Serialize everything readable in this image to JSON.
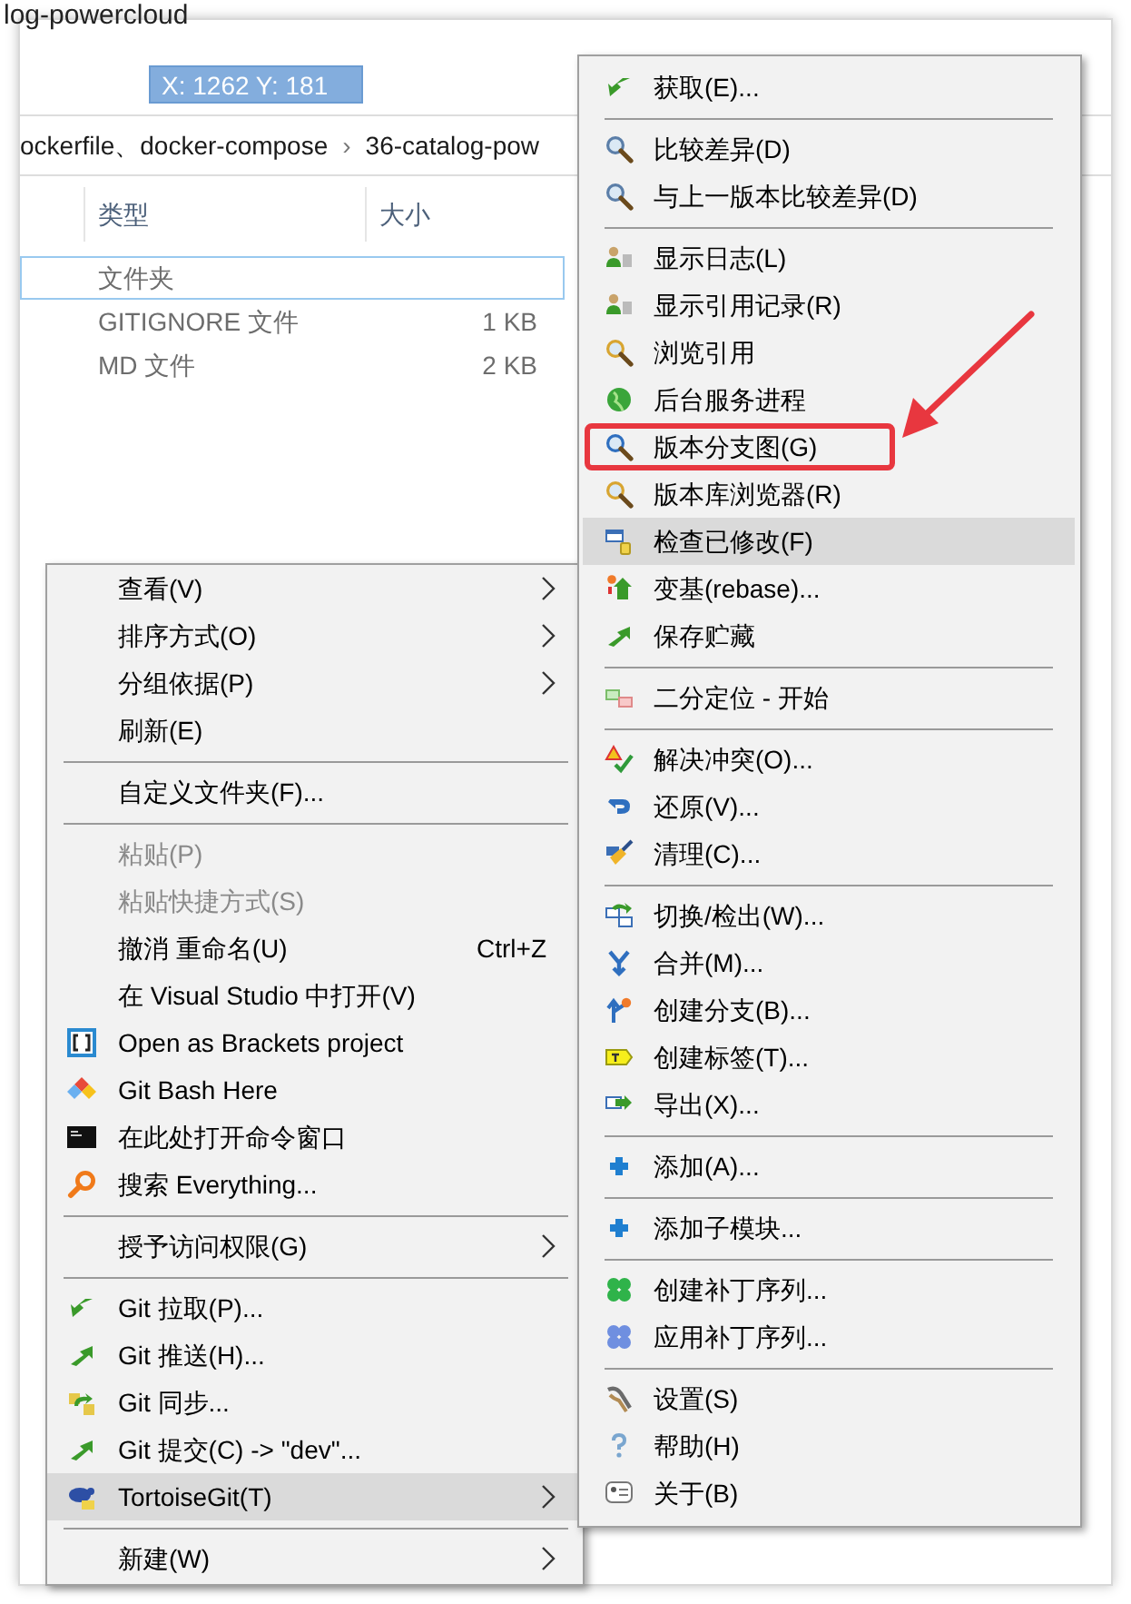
{
  "explorer": {
    "title": "log-powercloud",
    "breadcrumb": [
      {
        "label": "ockerfile、docker-compose"
      },
      {
        "label": "›"
      },
      {
        "label": "36-catalog-pow"
      }
    ],
    "tooltip": "X: 1262 Y: 181",
    "columns": [
      "类型",
      "大小"
    ],
    "rows": [
      {
        "type": "文件夹",
        "size": "",
        "selected": true
      },
      {
        "type": "GITIGNORE 文件",
        "size": "1 KB",
        "selected": false
      },
      {
        "type": "MD 文件",
        "size": "2 KB",
        "selected": false
      }
    ]
  },
  "context_menu": {
    "items": [
      {
        "kind": "item",
        "label": "查看(V)",
        "submenu": true,
        "disabled": false,
        "selected": false
      },
      {
        "kind": "item",
        "label": "排序方式(O)",
        "submenu": true,
        "disabled": false,
        "selected": false
      },
      {
        "kind": "item",
        "label": "分组依据(P)",
        "submenu": true,
        "disabled": false,
        "selected": false
      },
      {
        "kind": "item",
        "label": "刷新(E)",
        "submenu": false,
        "disabled": false,
        "selected": false
      },
      {
        "kind": "separator"
      },
      {
        "kind": "item",
        "label": "自定义文件夹(F)...",
        "submenu": false,
        "disabled": false,
        "selected": false
      },
      {
        "kind": "separator"
      },
      {
        "kind": "item",
        "label": "粘贴(P)",
        "submenu": false,
        "disabled": true,
        "selected": false
      },
      {
        "kind": "item",
        "label": "粘贴快捷方式(S)",
        "submenu": false,
        "disabled": true,
        "selected": false
      },
      {
        "kind": "item",
        "label": "撤消 重命名(U)",
        "shortcut": "Ctrl+Z",
        "submenu": false,
        "disabled": false,
        "selected": false
      },
      {
        "kind": "item",
        "label": "在 Visual Studio 中打开(V)",
        "submenu": false,
        "disabled": false,
        "selected": false
      },
      {
        "kind": "item",
        "label": "Open as Brackets project",
        "submenu": false,
        "disabled": false,
        "selected": false
      },
      {
        "kind": "item",
        "label": "Git Bash Here",
        "submenu": false,
        "disabled": false,
        "selected": false
      },
      {
        "kind": "item",
        "label": "在此处打开命令窗口",
        "submenu": false,
        "disabled": false,
        "selected": false
      },
      {
        "kind": "item",
        "label": "搜索 Everything...",
        "submenu": false,
        "disabled": false,
        "selected": false
      },
      {
        "kind": "separator"
      },
      {
        "kind": "item",
        "label": "授予访问权限(G)",
        "submenu": true,
        "disabled": false,
        "selected": false
      },
      {
        "kind": "separator"
      },
      {
        "kind": "item",
        "label": "Git 拉取(P)...",
        "submenu": false,
        "disabled": false,
        "selected": false
      },
      {
        "kind": "item",
        "label": "Git 推送(H)...",
        "submenu": false,
        "disabled": false,
        "selected": false
      },
      {
        "kind": "item",
        "label": "Git 同步...",
        "submenu": false,
        "disabled": false,
        "selected": false
      },
      {
        "kind": "item",
        "label": "Git 提交(C) -> \"dev\"...",
        "submenu": false,
        "disabled": false,
        "selected": false
      },
      {
        "kind": "item",
        "label": "TortoiseGit(T)",
        "submenu": true,
        "disabled": false,
        "selected": true
      },
      {
        "kind": "separator"
      },
      {
        "kind": "item",
        "label": "新建(W)",
        "submenu": true,
        "disabled": false,
        "selected": false
      }
    ]
  },
  "submenu": {
    "items": [
      {
        "kind": "item",
        "label": "获取(E)...",
        "selected": false,
        "annotated": false
      },
      {
        "kind": "separator"
      },
      {
        "kind": "item",
        "label": "比较差异(D)",
        "selected": false,
        "annotated": false
      },
      {
        "kind": "item",
        "label": "与上一版本比较差异(D)",
        "selected": false,
        "annotated": false
      },
      {
        "kind": "separator"
      },
      {
        "kind": "item",
        "label": "显示日志(L)",
        "selected": false,
        "annotated": false
      },
      {
        "kind": "item",
        "label": "显示引用记录(R)",
        "selected": false,
        "annotated": false
      },
      {
        "kind": "item",
        "label": "浏览引用",
        "selected": false,
        "annotated": false
      },
      {
        "kind": "item",
        "label": "后台服务进程",
        "selected": false,
        "annotated": false
      },
      {
        "kind": "item",
        "label": "版本分支图(G)",
        "selected": false,
        "annotated": true
      },
      {
        "kind": "item",
        "label": "版本库浏览器(R)",
        "selected": false,
        "annotated": false
      },
      {
        "kind": "item",
        "label": "检查已修改(F)",
        "selected": true,
        "annotated": false
      },
      {
        "kind": "item",
        "label": "变基(rebase)...",
        "selected": false,
        "annotated": false
      },
      {
        "kind": "item",
        "label": "保存贮藏",
        "selected": false,
        "annotated": false
      },
      {
        "kind": "separator"
      },
      {
        "kind": "item",
        "label": "二分定位 - 开始",
        "selected": false,
        "annotated": false
      },
      {
        "kind": "separator"
      },
      {
        "kind": "item",
        "label": "解决冲突(O)...",
        "selected": false,
        "annotated": false
      },
      {
        "kind": "item",
        "label": "还原(V)...",
        "selected": false,
        "annotated": false
      },
      {
        "kind": "item",
        "label": "清理(C)...",
        "selected": false,
        "annotated": false
      },
      {
        "kind": "separator"
      },
      {
        "kind": "item",
        "label": "切换/检出(W)...",
        "selected": false,
        "annotated": false
      },
      {
        "kind": "item",
        "label": "合并(M)...",
        "selected": false,
        "annotated": false
      },
      {
        "kind": "item",
        "label": "创建分支(B)...",
        "selected": false,
        "annotated": false
      },
      {
        "kind": "item",
        "label": "创建标签(T)...",
        "selected": false,
        "annotated": false
      },
      {
        "kind": "item",
        "label": "导出(X)...",
        "selected": false,
        "annotated": false
      },
      {
        "kind": "separator"
      },
      {
        "kind": "item",
        "label": "添加(A)...",
        "selected": false,
        "annotated": false
      },
      {
        "kind": "separator"
      },
      {
        "kind": "item",
        "label": "添加子模块...",
        "selected": false,
        "annotated": false
      },
      {
        "kind": "separator"
      },
      {
        "kind": "item",
        "label": "创建补丁序列...",
        "selected": false,
        "annotated": false
      },
      {
        "kind": "item",
        "label": "应用补丁序列...",
        "selected": false,
        "annotated": false
      },
      {
        "kind": "separator"
      },
      {
        "kind": "item",
        "label": "设置(S)",
        "selected": false,
        "annotated": false
      },
      {
        "kind": "item",
        "label": "帮助(H)",
        "selected": false,
        "annotated": false
      },
      {
        "kind": "item",
        "label": "关于(B)",
        "selected": false,
        "annotated": false
      }
    ]
  }
}
